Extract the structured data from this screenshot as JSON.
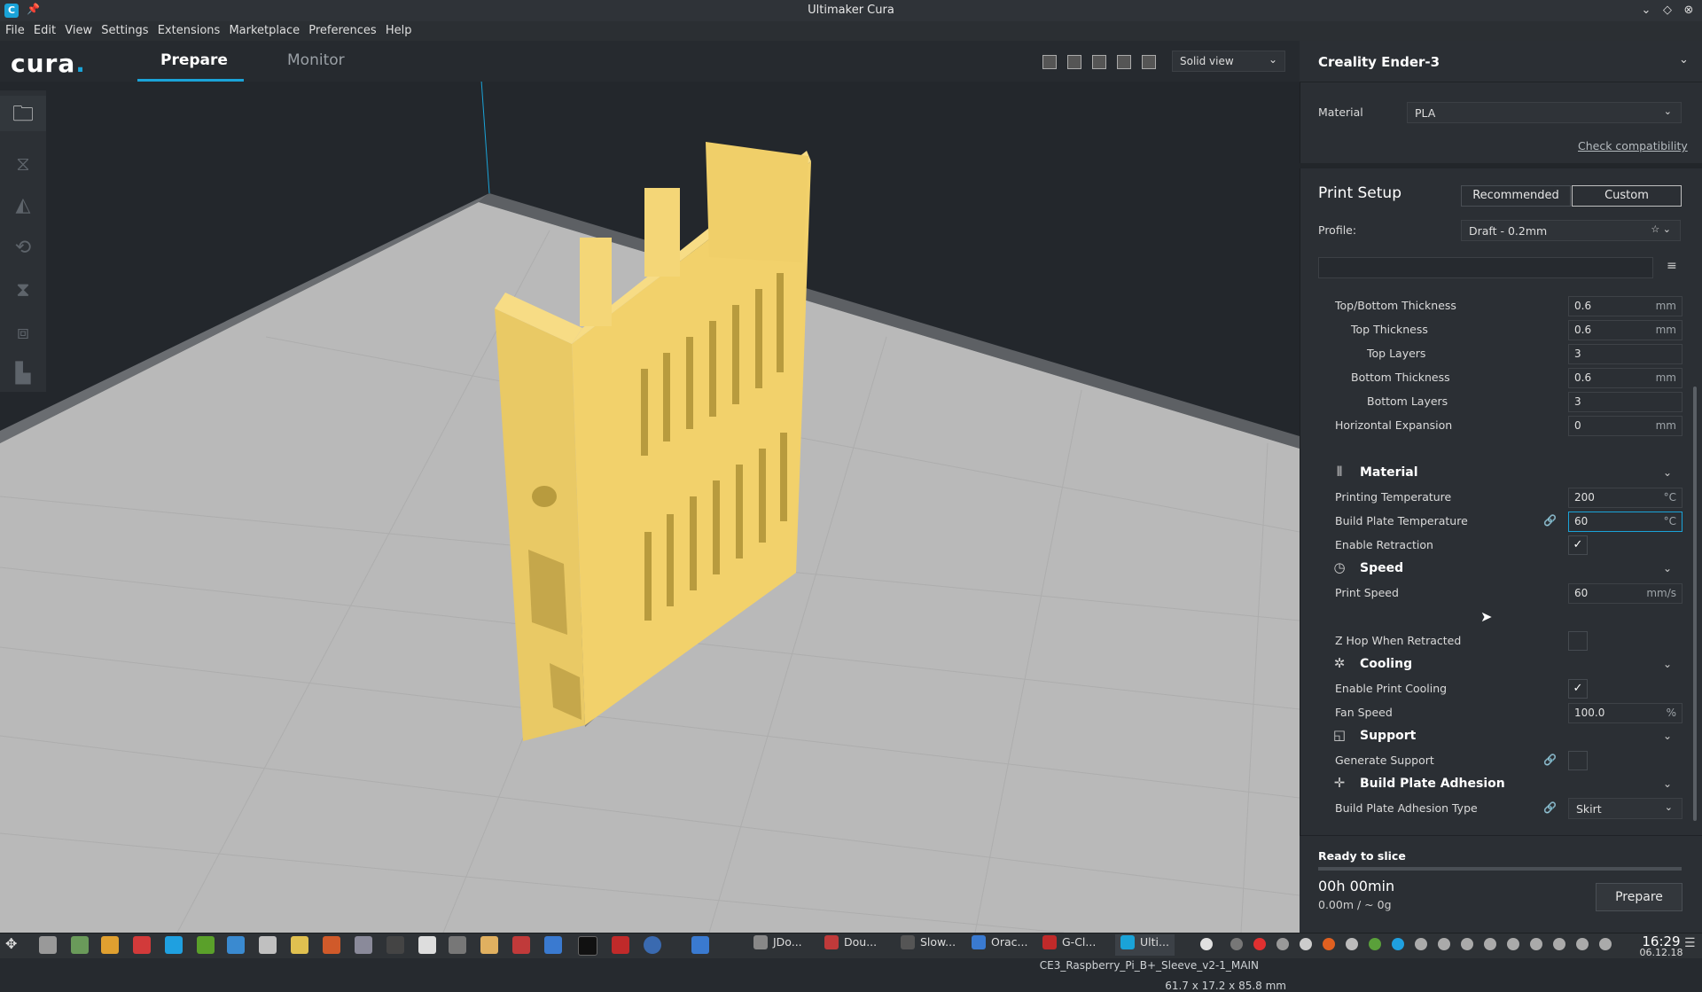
{
  "window": {
    "title": "Ultimaker Cura"
  },
  "menu": [
    "File",
    "Edit",
    "View",
    "Settings",
    "Extensions",
    "Marketplace",
    "Preferences",
    "Help"
  ],
  "header": {
    "logo": "cura",
    "logo_dot": ".",
    "tabs": {
      "prepare": "Prepare",
      "monitor": "Monitor"
    },
    "view_mode": "Solid view"
  },
  "viewport": {
    "model_name": "CE3_Raspberry_Pi_B+_Sleeve_v2-1_MAIN",
    "model_dims": "61.7 x 17.2 x 85.8 mm"
  },
  "printer": {
    "name": "Creality Ender-3",
    "material_label": "Material",
    "material_value": "PLA",
    "check_compat": "Check compatibility"
  },
  "print_setup": {
    "title": "Print Setup",
    "recommended": "Recommended",
    "custom": "Custom",
    "profile_label": "Profile:",
    "profile_value": "Draft - 0.2mm"
  },
  "settings": {
    "top_bottom_thickness": {
      "label": "Top/Bottom Thickness",
      "value": "0.6",
      "unit": "mm"
    },
    "top_thickness": {
      "label": "Top Thickness",
      "value": "0.6",
      "unit": "mm"
    },
    "top_layers": {
      "label": "Top Layers",
      "value": "3"
    },
    "bottom_thickness": {
      "label": "Bottom Thickness",
      "value": "0.6",
      "unit": "mm"
    },
    "bottom_layers": {
      "label": "Bottom Layers",
      "value": "3"
    },
    "horizontal_expansion": {
      "label": "Horizontal Expansion",
      "value": "0",
      "unit": "mm"
    },
    "cat_material": "Material",
    "printing_temp": {
      "label": "Printing Temperature",
      "value": "200",
      "unit": "°C"
    },
    "build_plate_temp": {
      "label": "Build Plate Temperature",
      "value": "60",
      "unit": "°C"
    },
    "enable_retraction": {
      "label": "Enable Retraction",
      "mark": "✓"
    },
    "cat_speed": "Speed",
    "print_speed": {
      "label": "Print Speed",
      "value": "60",
      "unit": "mm/s"
    },
    "z_hop": {
      "label": "Z Hop When Retracted",
      "mark": ""
    },
    "cat_cooling": "Cooling",
    "enable_cooling": {
      "label": "Enable Print Cooling",
      "mark": "✓"
    },
    "fan_speed": {
      "label": "Fan Speed",
      "value": "100.0",
      "unit": "%"
    },
    "cat_support": "Support",
    "generate_support": {
      "label": "Generate Support",
      "mark": ""
    },
    "cat_adhesion": "Build Plate Adhesion",
    "adhesion_type": {
      "label": "Build Plate Adhesion Type",
      "value": "Skirt"
    }
  },
  "slice": {
    "status": "Ready to slice",
    "time": "00h 00min",
    "usage": "0.00m / ~ 0g",
    "button": "Prepare"
  },
  "taskbar": {
    "tasks": [
      "JDo...",
      "Dou...",
      "Slow...",
      "Orac...",
      "G-Cl...",
      "Ulti..."
    ],
    "time": "16:29",
    "date": "06.12.18"
  },
  "colors": {
    "accent": "#1aa3d8",
    "model": "#f2d16b",
    "panel": "#2b2f34"
  }
}
